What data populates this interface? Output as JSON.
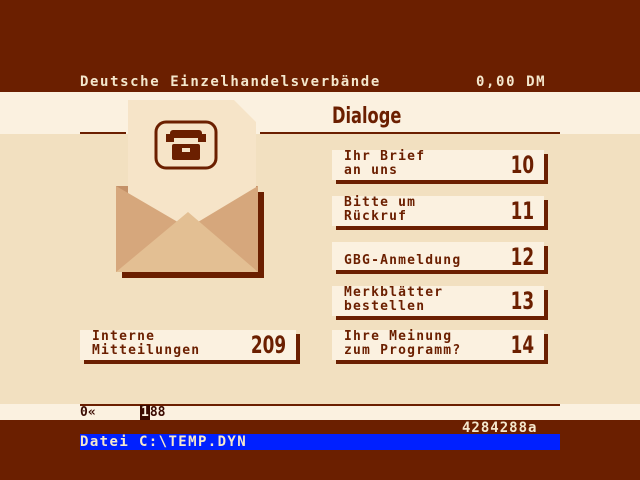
{
  "header": {
    "title": "Deutsche Einzelhandelsverbände",
    "cost": "0,00 DM"
  },
  "section": {
    "title": "Dialoge"
  },
  "tiles": [
    {
      "label": "Ihr Brief\nan uns",
      "number": "10"
    },
    {
      "label": "Bitte um\nRückruf",
      "number": "11"
    },
    {
      "label": "GBG-Anmeldung",
      "number": "12"
    },
    {
      "label": "Merkblätter\nbestellen",
      "number": "13"
    },
    {
      "label": "Ihre Meinung\nzum Programm?",
      "number": "14"
    }
  ],
  "internal": {
    "label": "Interne\nMitteilungen",
    "number": "209"
  },
  "status": {
    "left": "0«",
    "box_char": "1",
    "box_rest": "88"
  },
  "counter": "4284288a",
  "file": "Datei C:\\TEMP.DYN",
  "icons": {
    "envelope": "envelope-with-telephone-icon"
  }
}
